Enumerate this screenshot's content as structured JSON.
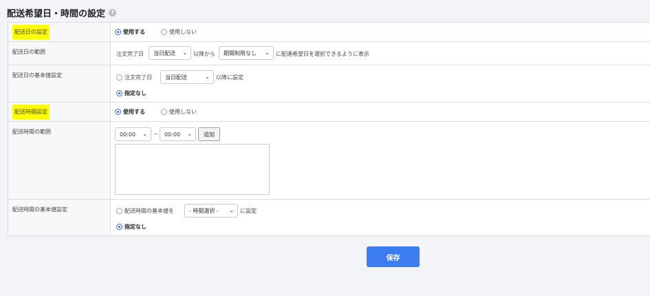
{
  "page": {
    "title": "配送希望日・時間の設定",
    "help_icon": "?"
  },
  "delivery_date_setting": {
    "label": "配送日の設定",
    "use_label": "使用する",
    "nouse_label": "使用しない",
    "selected": "use"
  },
  "delivery_date_range": {
    "label": "配送日の範囲",
    "prefix": "注文完了日",
    "start_select": "当日配送",
    "middle": "以降から",
    "end_select": "期間制限なし",
    "suffix": "に配達希望日を選択できるように表示"
  },
  "delivery_date_default": {
    "label": "配送日の基本値設定",
    "option1_prefix": "注文完了日",
    "option1_select": "当日配送",
    "option1_suffix": "以降に設定",
    "option2_label": "指定なし",
    "selected": "none"
  },
  "delivery_time_setting": {
    "label": "配送時間設定",
    "use_label": "使用する",
    "nouse_label": "使用しない",
    "selected": "use"
  },
  "delivery_time_range": {
    "label": "配送時間の範囲",
    "from_select": "00:00",
    "tilde": "~",
    "to_select": "00:00",
    "add_button": "追加"
  },
  "delivery_time_default": {
    "label": "配送時間の基本値設定",
    "option1_prefix": "配送時間の基本値を",
    "option1_select": "- 時間選択 -",
    "option1_suffix": "に設定",
    "option2_label": "指定なし",
    "selected": "none"
  },
  "save_button": "保存",
  "colors": {
    "highlight": "#ffff00",
    "primary": "#3b7cf0"
  },
  "icons": {
    "help": "help-icon",
    "chevron": "chevron-down-icon"
  }
}
